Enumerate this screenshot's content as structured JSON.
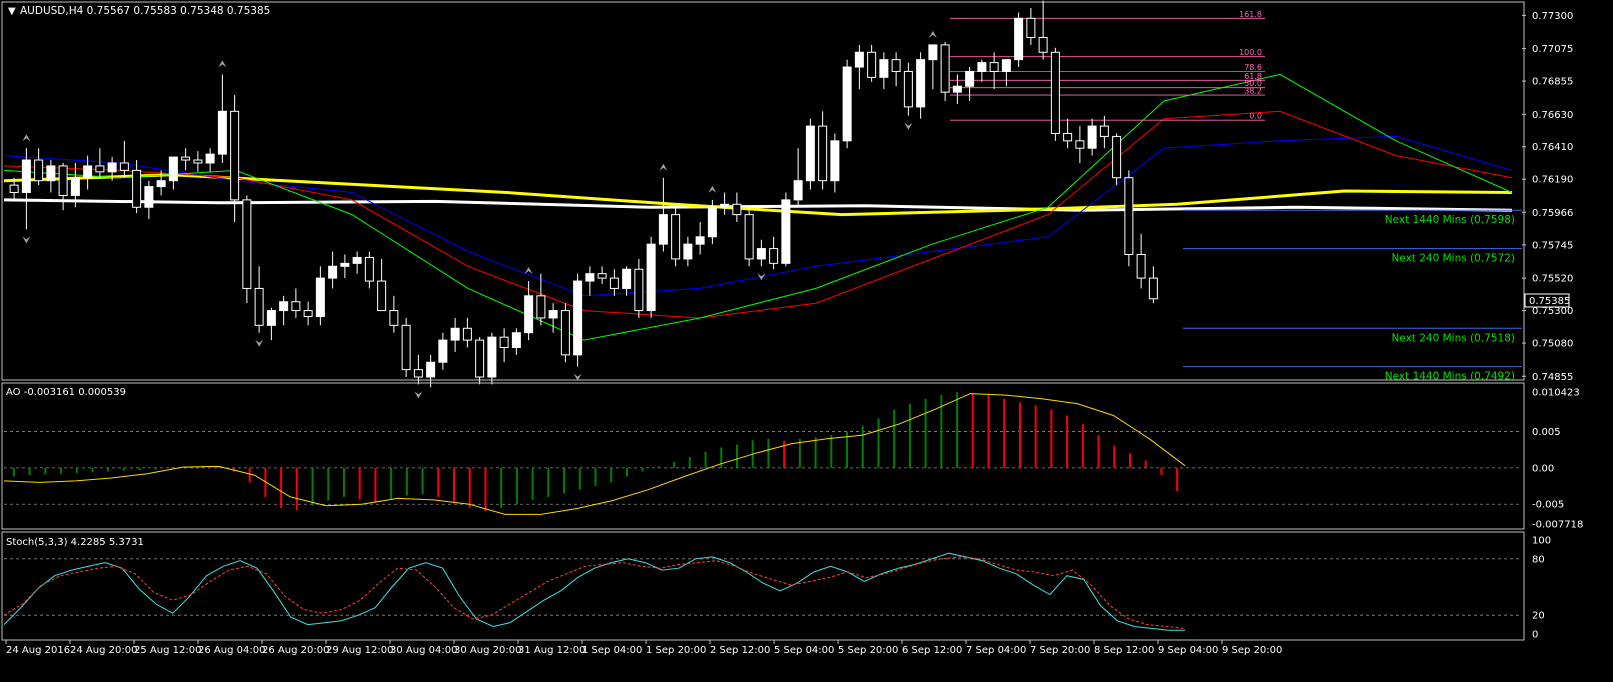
{
  "colors": {
    "background": "#000000",
    "frame": "#c0c0c0",
    "grid": "#8a8a8a",
    "text": "#ffffff",
    "bull_body": "#ffffff",
    "bear_body": "#000000",
    "candle_wick": "#ffffff",
    "ma_white": "#ffffff",
    "ma_yellow": "#ffff00",
    "ma_blue": "#0000ff",
    "ma_red": "#ff0000",
    "ma_green": "#00ff00",
    "level_blue": "#4169e1",
    "level_label": "#00e000",
    "fib": "#ff69b4",
    "fractal": "#a0a0a0",
    "ao_up": "#008000",
    "ao_down": "#ff0000",
    "ao_signal": "#ffd700",
    "stoch_main": "#40e0e0",
    "stoch_signal": "#ff4040"
  },
  "icons": {
    "symbol_menu": "triangle-down-icon",
    "fractal_up": "arrow-up-icon",
    "fractal_down": "arrow-down-icon"
  },
  "header": {
    "symbol_line": "AUDUSD,H4  0.75567 0.75583 0.75348 0.75385"
  },
  "chart_data": [
    {
      "type": "candlestick",
      "panel": "price",
      "symbol": "AUDUSD",
      "timeframe": "H4",
      "ohlc_header": [
        0.75567,
        0.75583,
        0.75348,
        0.75385
      ],
      "y_ticks": [
        "0.77300",
        "0.77075",
        "0.76855",
        "0.76630",
        "0.76410",
        "0.76190",
        "0.75966",
        "0.75745",
        "0.75520",
        "0.75300",
        "0.75080",
        "0.74855"
      ],
      "ylim": [
        0.7485,
        0.7735
      ],
      "current_price_label": "0.75385",
      "x_ticks": [
        "24 Aug 2016",
        "24 Aug 20:00",
        "25 Aug 12:00",
        "26 Aug 04:00",
        "26 Aug 20:00",
        "29 Aug 12:00",
        "30 Aug 04:00",
        "30 Aug 20:00",
        "31 Aug 12:00",
        "1 Sep 04:00",
        "1 Sep 20:00",
        "2 Sep 12:00",
        "5 Sep 04:00",
        "5 Sep 20:00",
        "6 Sep 12:00",
        "7 Sep 04:00",
        "7 Sep 20:00",
        "8 Sep 12:00",
        "9 Sep 04:00",
        "9 Sep 20:00"
      ],
      "candles": [
        [
          0.7615,
          0.762,
          0.7605,
          0.761
        ],
        [
          0.761,
          0.764,
          0.7585,
          0.7632
        ],
        [
          0.7632,
          0.764,
          0.7615,
          0.7618
        ],
        [
          0.7618,
          0.7632,
          0.761,
          0.7628
        ],
        [
          0.7628,
          0.763,
          0.7598,
          0.7608
        ],
        [
          0.7608,
          0.763,
          0.76,
          0.762
        ],
        [
          0.762,
          0.7635,
          0.7612,
          0.7628
        ],
        [
          0.7628,
          0.764,
          0.762,
          0.7624
        ],
        [
          0.7624,
          0.7634,
          0.7618,
          0.763
        ],
        [
          0.763,
          0.7645,
          0.762,
          0.7625
        ],
        [
          0.7625,
          0.7632,
          0.7596,
          0.76
        ],
        [
          0.76,
          0.7618,
          0.7592,
          0.7614
        ],
        [
          0.7614,
          0.7625,
          0.7608,
          0.7618
        ],
        [
          0.7618,
          0.763,
          0.7612,
          0.7634
        ],
        [
          0.7634,
          0.764,
          0.7625,
          0.7632
        ],
        [
          0.7632,
          0.7638,
          0.7624,
          0.763
        ],
        [
          0.763,
          0.764,
          0.7624,
          0.7636
        ],
        [
          0.7636,
          0.769,
          0.763,
          0.7665
        ],
        [
          0.7665,
          0.7676,
          0.759,
          0.7605
        ],
        [
          0.7605,
          0.7608,
          0.7535,
          0.7545
        ],
        [
          0.7545,
          0.756,
          0.7515,
          0.752
        ],
        [
          0.752,
          0.7532,
          0.751,
          0.753
        ],
        [
          0.753,
          0.754,
          0.752,
          0.7536
        ],
        [
          0.7536,
          0.7545,
          0.7525,
          0.753
        ],
        [
          0.753,
          0.7536,
          0.752,
          0.7526
        ],
        [
          0.7526,
          0.756,
          0.752,
          0.7552
        ],
        [
          0.7552,
          0.757,
          0.7545,
          0.756
        ],
        [
          0.756,
          0.7568,
          0.7552,
          0.7562
        ],
        [
          0.7562,
          0.757,
          0.7555,
          0.7566
        ],
        [
          0.7566,
          0.757,
          0.7545,
          0.755
        ],
        [
          0.755,
          0.7565,
          0.754,
          0.753
        ],
        [
          0.753,
          0.754,
          0.7515,
          0.752
        ],
        [
          0.752,
          0.7525,
          0.7485,
          0.749
        ],
        [
          0.749,
          0.75,
          0.748,
          0.7485
        ],
        [
          0.7485,
          0.75,
          0.7478,
          0.7495
        ],
        [
          0.7495,
          0.7515,
          0.749,
          0.751
        ],
        [
          0.751,
          0.7525,
          0.7502,
          0.7518
        ],
        [
          0.7518,
          0.7525,
          0.7505,
          0.751
        ],
        [
          0.751,
          0.7512,
          0.748,
          0.7485
        ],
        [
          0.7485,
          0.7515,
          0.748,
          0.7512
        ],
        [
          0.7512,
          0.7518,
          0.7495,
          0.7505
        ],
        [
          0.7505,
          0.7518,
          0.75,
          0.7515
        ],
        [
          0.7515,
          0.755,
          0.751,
          0.754
        ],
        [
          0.754,
          0.7555,
          0.752,
          0.7525
        ],
        [
          0.7525,
          0.7535,
          0.7515,
          0.753
        ],
        [
          0.753,
          0.7535,
          0.7495,
          0.75
        ],
        [
          0.75,
          0.7555,
          0.7492,
          0.755
        ],
        [
          0.755,
          0.756,
          0.754,
          0.7555
        ],
        [
          0.7555,
          0.756,
          0.7548,
          0.7552
        ],
        [
          0.7552,
          0.7558,
          0.754,
          0.7545
        ],
        [
          0.7545,
          0.756,
          0.754,
          0.7558
        ],
        [
          0.7558,
          0.7565,
          0.7525,
          0.753
        ],
        [
          0.753,
          0.758,
          0.7525,
          0.7575
        ],
        [
          0.7575,
          0.762,
          0.757,
          0.7595
        ],
        [
          0.7595,
          0.76,
          0.756,
          0.7565
        ],
        [
          0.7565,
          0.758,
          0.756,
          0.7575
        ],
        [
          0.7575,
          0.759,
          0.7568,
          0.758
        ],
        [
          0.758,
          0.7605,
          0.7575,
          0.76
        ],
        [
          0.76,
          0.761,
          0.7595,
          0.7602
        ],
        [
          0.7602,
          0.761,
          0.759,
          0.7595
        ],
        [
          0.7595,
          0.76,
          0.756,
          0.7565
        ],
        [
          0.7565,
          0.7578,
          0.756,
          0.7572
        ],
        [
          0.7572,
          0.758,
          0.7558,
          0.7562
        ],
        [
          0.7562,
          0.761,
          0.756,
          0.7605
        ],
        [
          0.7605,
          0.764,
          0.76,
          0.7618
        ],
        [
          0.7618,
          0.766,
          0.7612,
          0.7655
        ],
        [
          0.7655,
          0.7665,
          0.7612,
          0.7618
        ],
        [
          0.7618,
          0.765,
          0.761,
          0.7645
        ],
        [
          0.7645,
          0.77,
          0.764,
          0.7695
        ],
        [
          0.7695,
          0.771,
          0.768,
          0.7705
        ],
        [
          0.7705,
          0.771,
          0.7685,
          0.7688
        ],
        [
          0.7688,
          0.7705,
          0.768,
          0.77
        ],
        [
          0.77,
          0.7705,
          0.7682,
          0.7692
        ],
        [
          0.7692,
          0.7698,
          0.7662,
          0.7668
        ],
        [
          0.7668,
          0.7705,
          0.766,
          0.77
        ],
        [
          0.77,
          0.771,
          0.768,
          0.771
        ],
        [
          0.771,
          0.7712,
          0.7672,
          0.7678
        ],
        [
          0.7678,
          0.769,
          0.767,
          0.7682
        ],
        [
          0.7682,
          0.7695,
          0.7672,
          0.7692
        ],
        [
          0.7692,
          0.77,
          0.7685,
          0.7698
        ],
        [
          0.7698,
          0.7705,
          0.768,
          0.7692
        ],
        [
          0.7692,
          0.77,
          0.7682,
          0.77
        ],
        [
          0.77,
          0.7732,
          0.7695,
          0.7728
        ],
        [
          0.7728,
          0.7735,
          0.771,
          0.7715
        ],
        [
          0.7715,
          0.774,
          0.77,
          0.7705
        ],
        [
          0.7705,
          0.7708,
          0.7645,
          0.765
        ],
        [
          0.765,
          0.766,
          0.764,
          0.7645
        ],
        [
          0.7645,
          0.7655,
          0.763,
          0.764
        ],
        [
          0.764,
          0.766,
          0.7635,
          0.7655
        ],
        [
          0.7655,
          0.7662,
          0.764,
          0.7648
        ],
        [
          0.7648,
          0.765,
          0.7615,
          0.762
        ],
        [
          0.762,
          0.7625,
          0.756,
          0.7568
        ],
        [
          0.7568,
          0.7582,
          0.7545,
          0.7552
        ],
        [
          0.7552,
          0.756,
          0.7535,
          0.7538
        ]
      ],
      "levels": [
        {
          "label": "Next 1440 Mins (0.7598)",
          "value": 0.7598
        },
        {
          "label": "Next 240 Mins (0.7572)",
          "value": 0.7572
        },
        {
          "label": "Next 240 Mins (0.7518)",
          "value": 0.7518
        },
        {
          "label": "Next 1440 Mins (0.7492)",
          "value": 0.7492
        }
      ],
      "fibonacci": [
        {
          "label": "161.8",
          "value": 0.7728
        },
        {
          "label": "100.0",
          "value": 0.7702
        },
        {
          "label": "78.6",
          "value": 0.7692
        },
        {
          "label": "61.8",
          "value": 0.7686
        },
        {
          "label": "50.0",
          "value": 0.7681
        },
        {
          "label": "38.2",
          "value": 0.7676
        },
        {
          "label": "0.0",
          "value": 0.7659
        }
      ],
      "moving_averages": [
        {
          "color": "#ffffff",
          "points": [
            [
              0.7605,
              0.7603
            ],
            [
              0.7604,
              0.76
            ],
            [
              0.7601,
              0.7598
            ],
            [
              0.76,
              0.7598
            ]
          ]
        },
        {
          "color": "#ffff00",
          "points": [
            [
              0.7618,
              0.7622
            ],
            [
              0.7616,
              0.761
            ],
            [
              0.7602,
              0.7595
            ],
            [
              0.7598,
              0.7602
            ],
            [
              0.7611,
              0.761
            ]
          ]
        },
        {
          "color": "#0000ff",
          "points": [
            [
              0.7635,
              0.763
            ],
            [
              0.7618,
              0.761
            ],
            [
              0.757,
              0.754
            ],
            [
              0.7545,
              0.756
            ],
            [
              0.757,
              0.758
            ],
            [
              0.764,
              0.7645
            ],
            [
              0.7648,
              0.7625
            ]
          ]
        },
        {
          "color": "#ff0000",
          "points": [
            [
              0.7628,
              0.7625
            ],
            [
              0.762,
              0.7605
            ],
            [
              0.756,
              0.753
            ],
            [
              0.7525,
              0.7535
            ],
            [
              0.7565,
              0.7595
            ],
            [
              0.766,
              0.7665
            ],
            [
              0.7635,
              0.762
            ]
          ]
        },
        {
          "color": "#00ff00",
          "points": [
            [
              0.7625,
              0.762
            ],
            [
              0.7625,
              0.7595
            ],
            [
              0.7545,
              0.751
            ],
            [
              0.7525,
              0.7545
            ],
            [
              0.7575,
              0.76
            ],
            [
              0.7672,
              0.769
            ],
            [
              0.7645,
              0.761
            ]
          ]
        }
      ],
      "fractals": [
        {
          "direction": "down",
          "candle": 1,
          "value": 0.7585
        },
        {
          "direction": "up",
          "candle": 1,
          "value": 0.764
        },
        {
          "direction": "up",
          "candle": 17,
          "value": 0.769
        },
        {
          "direction": "down",
          "candle": 20,
          "value": 0.7515
        },
        {
          "direction": "down",
          "candle": 33,
          "value": 0.748
        },
        {
          "direction": "up",
          "candle": 42,
          "value": 0.755
        },
        {
          "direction": "down",
          "candle": 46,
          "value": 0.7492
        },
        {
          "direction": "up",
          "candle": 53,
          "value": 0.762
        },
        {
          "direction": "up",
          "candle": 57,
          "value": 0.7605
        },
        {
          "direction": "down",
          "candle": 61,
          "value": 0.756
        },
        {
          "direction": "up",
          "candle": 75,
          "value": 0.771
        },
        {
          "direction": "down",
          "candle": 73,
          "value": 0.7662
        },
        {
          "direction": "up",
          "candle": 84,
          "value": 0.774
        }
      ],
      "grid": true
    },
    {
      "type": "bar",
      "panel": "indicator",
      "header": "AO -0.003161 0.000539",
      "y_ticks": [
        "0.010423",
        "0.005",
        "0.00",
        "-0.005",
        "-0.007718"
      ],
      "ylim": [
        -0.007718,
        0.010423
      ],
      "values": [
        -0.0012,
        -0.001,
        -0.0009,
        -0.0008,
        -0.0007,
        -0.0006,
        -0.0005,
        -0.0004,
        -0.0003,
        -0.0002,
        -0.0001,
        0.0001,
        0.0003,
        0.0002,
        -0.0005,
        -0.002,
        -0.004,
        -0.0055,
        -0.0058,
        -0.0052,
        -0.0045,
        -0.004,
        -0.0043,
        -0.0047,
        -0.0044,
        -0.0038,
        -0.0036,
        -0.004,
        -0.0048,
        -0.0055,
        -0.006,
        -0.0055,
        -0.005,
        -0.0044,
        -0.004,
        -0.0035,
        -0.003,
        -0.0025,
        -0.002,
        -0.0012,
        -0.0005,
        0.0002,
        0.0008,
        0.0015,
        0.0022,
        0.0028,
        0.0032,
        0.0038,
        0.004,
        0.0037,
        0.004,
        0.0042,
        0.0045,
        0.005,
        0.0058,
        0.0068,
        0.008,
        0.0088,
        0.0095,
        0.01,
        0.0104,
        0.0102,
        0.01,
        0.0095,
        0.009,
        0.0086,
        0.008,
        0.0072,
        0.006,
        0.0045,
        0.003,
        0.002,
        0.001,
        -0.001,
        -0.0032
      ],
      "signal": [
        -0.0018,
        -0.002,
        -0.0018,
        -0.0014,
        -0.0008,
        0.0001,
        0.0002,
        -0.001,
        -0.004,
        -0.0052,
        -0.005,
        -0.0042,
        -0.0044,
        -0.005,
        -0.0064,
        -0.0064,
        -0.0056,
        -0.0045,
        -0.003,
        -0.0012,
        0.0005,
        0.002,
        0.0033,
        0.004,
        0.0045,
        0.006,
        0.008,
        0.0102,
        0.01,
        0.0095,
        0.0088,
        0.0072,
        0.004,
        0.0003
      ],
      "grid": true
    },
    {
      "type": "line",
      "panel": "indicator",
      "header": "Stoch(5,3,3) 4.2285 5.3731",
      "y_ticks": [
        "100",
        "80",
        "20",
        "0"
      ],
      "ylim": [
        0,
        100
      ],
      "series": [
        {
          "values": [
            10,
            28,
            48,
            62,
            68,
            72,
            76,
            70,
            48,
            32,
            22,
            40,
            62,
            72,
            78,
            70,
            45,
            18,
            10,
            12,
            14,
            20,
            28,
            50,
            70,
            76,
            70,
            40,
            16,
            8,
            12,
            24,
            36,
            46,
            60,
            70,
            76,
            80,
            76,
            68,
            70,
            80,
            82,
            76,
            66,
            54,
            46,
            54,
            66,
            72,
            66,
            56,
            64,
            70,
            74,
            80,
            86,
            82,
            78,
            70,
            64,
            52,
            42,
            62,
            58,
            30,
            14,
            8,
            6,
            4,
            4
          ]
        },
        {
          "values": [
            20,
            32,
            52,
            62,
            66,
            70,
            72,
            64,
            44,
            36,
            42,
            56,
            68,
            72,
            64,
            40,
            26,
            22,
            26,
            36,
            54,
            70,
            68,
            50,
            28,
            16,
            20,
            32,
            44,
            56,
            64,
            72,
            74,
            76,
            72,
            70,
            74,
            76,
            78,
            72,
            64,
            58,
            52,
            56,
            60,
            66,
            60,
            64,
            70,
            76,
            80,
            82,
            80,
            74,
            68,
            66,
            62,
            68,
            52,
            30,
            16,
            10,
            8,
            6
          ]
        }
      ],
      "grid": true
    }
  ]
}
